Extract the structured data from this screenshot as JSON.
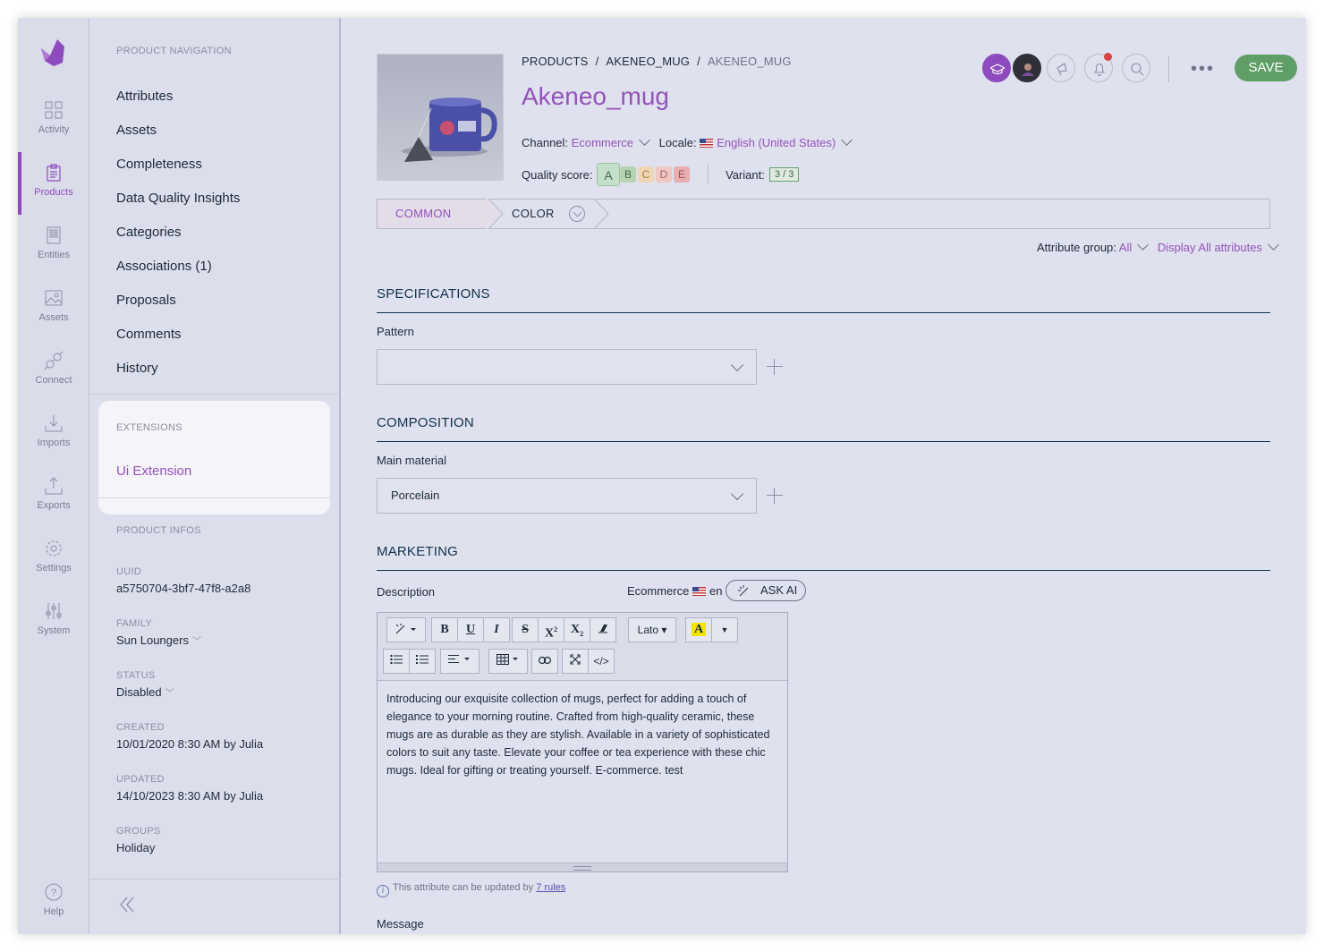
{
  "main_menu": {
    "items": [
      {
        "label": "Activity",
        "icon": "dashboard-icon"
      },
      {
        "label": "Products",
        "icon": "clipboard-icon"
      },
      {
        "label": "Entities",
        "icon": "entities-icon"
      },
      {
        "label": "Assets",
        "icon": "image-icon"
      },
      {
        "label": "Connect",
        "icon": "plug-icon"
      },
      {
        "label": "Imports",
        "icon": "import-icon"
      },
      {
        "label": "Exports",
        "icon": "export-icon"
      },
      {
        "label": "Settings",
        "icon": "gear-icon"
      },
      {
        "label": "System",
        "icon": "sliders-icon"
      }
    ],
    "help": "Help",
    "active": "Products",
    "accent": "#8e4bbd"
  },
  "product_nav": {
    "title": "PRODUCT NAVIGATION",
    "links": [
      "Attributes",
      "Assets",
      "Completeness",
      "Data Quality Insights",
      "Categories",
      "Associations (1)",
      "Proposals",
      "Comments",
      "History"
    ],
    "extensions_title": "EXTENSIONS",
    "extension_link": "Ui Extension",
    "infos_title": "PRODUCT INFOS",
    "infos": {
      "uuid_label": "UUID",
      "uuid": "a5750704-3bf7-47f8-a2a8",
      "family_label": "FAMILY",
      "family": "Sun Loungers",
      "status_label": "STATUS",
      "status": "Disabled",
      "created_label": "CREATED",
      "created": "10/01/2020 8:30 AM by Julia",
      "updated_label": "UPDATED",
      "updated": "14/10/2023 8:30 AM by Julia",
      "groups_label": "GROUPS",
      "groups": "Holiday"
    }
  },
  "header": {
    "breadcrumb": [
      "PRODUCTS",
      "AKENEO_MUG",
      "AKENEO_MUG"
    ],
    "breadcrumb_sep": "/",
    "title": "Akeneo_mug",
    "channel_label": "Channel:",
    "channel": "Ecommerce",
    "locale_label": "Locale:",
    "locale": "English (United States)",
    "quality_label": "Quality score:",
    "grades": [
      "A",
      "B",
      "C",
      "D",
      "E"
    ],
    "variant_label": "Variant:",
    "variant": "3 / 3",
    "more": "•••",
    "save": "SAVE",
    "save_color": "#5f9e67"
  },
  "tabs": [
    "COMMON",
    "COLOR"
  ],
  "filters": {
    "group_label": "Attribute group:",
    "group_value": "All",
    "display": "Display All attributes"
  },
  "sections": {
    "specifications": "SPECIFICATIONS",
    "pattern_label": "Pattern",
    "pattern_value": "",
    "composition": "COMPOSITION",
    "material_label": "Main material",
    "material_value": "Porcelain",
    "marketing": "MARKETING",
    "description_label": "Description",
    "description_channel": "Ecommerce",
    "description_locale": "en",
    "ask_ai": "ASK AI",
    "font": "Lato",
    "description_text": "Introducing our exquisite collection of mugs, perfect for adding a touch of elegance to your morning routine. Crafted from high-quality ceramic, these mugs are as durable as they are stylish. Available in a variety of sophisticated colors to suit any taste. Elevate your coffee or tea experience with these chic mugs. Ideal for gifting or treating yourself. E-commerce. test",
    "rules_note": "This attribute can be updated by",
    "rules_link": "7 rules",
    "message_label": "Message"
  }
}
